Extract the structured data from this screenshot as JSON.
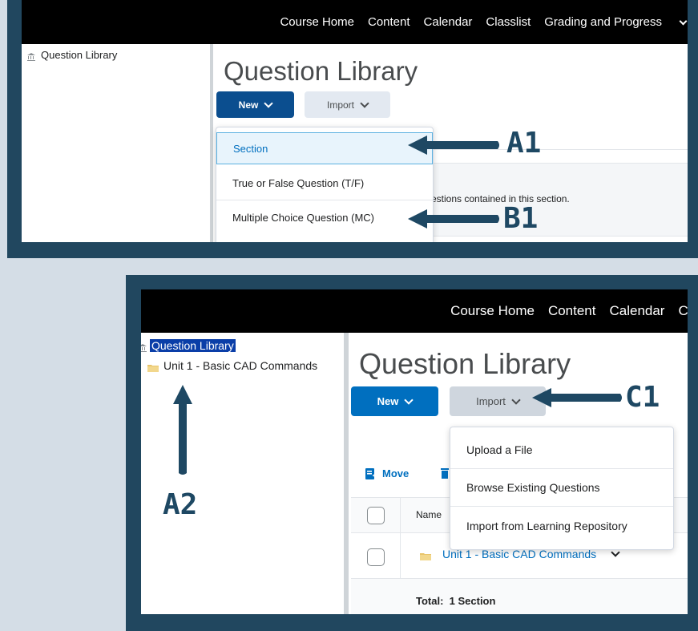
{
  "top": {
    "nav": [
      "Course Home",
      "Content",
      "Calendar",
      "Classlist",
      "Grading and Progress"
    ],
    "sidebar_root": "Question Library",
    "page_title": "Question Library",
    "new_label": "New",
    "import_label": "Import",
    "new_menu": [
      "Section",
      "True or False Question (T/F)",
      "Multiple Choice Question (MC)"
    ],
    "partial_text": "estions contained in this section."
  },
  "bottom": {
    "nav": [
      "Course Home",
      "Content",
      "Calendar",
      "Cla"
    ],
    "sidebar_root": "Question Library",
    "sidebar_child": "Unit 1 - Basic CAD Commands",
    "page_title": "Question Library",
    "new_label": "New",
    "import_label": "Import",
    "import_menu": [
      "Upload a File",
      "Browse Existing Questions",
      "Import from Learning Repository"
    ],
    "move_label": "Move",
    "col_name": "Name",
    "row_name": "Unit 1 - Basic CAD Commands",
    "total_label": "Total:  1 Section"
  },
  "callouts": {
    "a1": "A1",
    "b1": "B1",
    "c1": "C1",
    "a2": "A2"
  },
  "colors": {
    "frame": "#21475f",
    "callout": "#1e4863",
    "primary": "#006fbf",
    "secondary": "#e3e9f1"
  }
}
